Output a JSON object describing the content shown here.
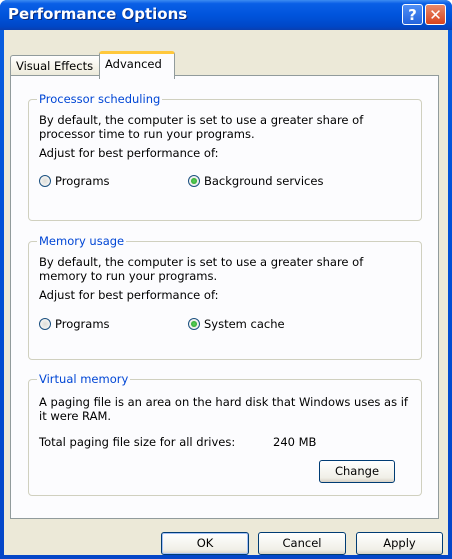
{
  "window": {
    "title": "Performance Options",
    "help_glyph": "?",
    "close_glyph": "✕"
  },
  "tabs": [
    {
      "label": "Visual Effects",
      "active": false
    },
    {
      "label": "Advanced",
      "active": true
    }
  ],
  "processor": {
    "legend": "Processor scheduling",
    "description": "By default, the computer is set to use a greater share of processor time to run your programs.",
    "prompt": "Adjust for best performance of:",
    "options": [
      {
        "label": "Programs",
        "selected": false
      },
      {
        "label": "Background services",
        "selected": true
      }
    ]
  },
  "memory": {
    "legend": "Memory usage",
    "description": "By default, the computer is set to use a greater share of memory to run your programs.",
    "prompt": "Adjust for best performance of:",
    "options": [
      {
        "label": "Programs",
        "selected": false
      },
      {
        "label": "System cache",
        "selected": true
      }
    ]
  },
  "virtual": {
    "legend": "Virtual memory",
    "description": "A paging file is an area on the hard disk that Windows uses as if it were RAM.",
    "total_label": "Total paging file size for all drives:",
    "total_value": "240 MB",
    "change_label": "Change"
  },
  "footer": {
    "ok_label": "OK",
    "cancel_label": "Cancel",
    "apply_label": "Apply"
  }
}
